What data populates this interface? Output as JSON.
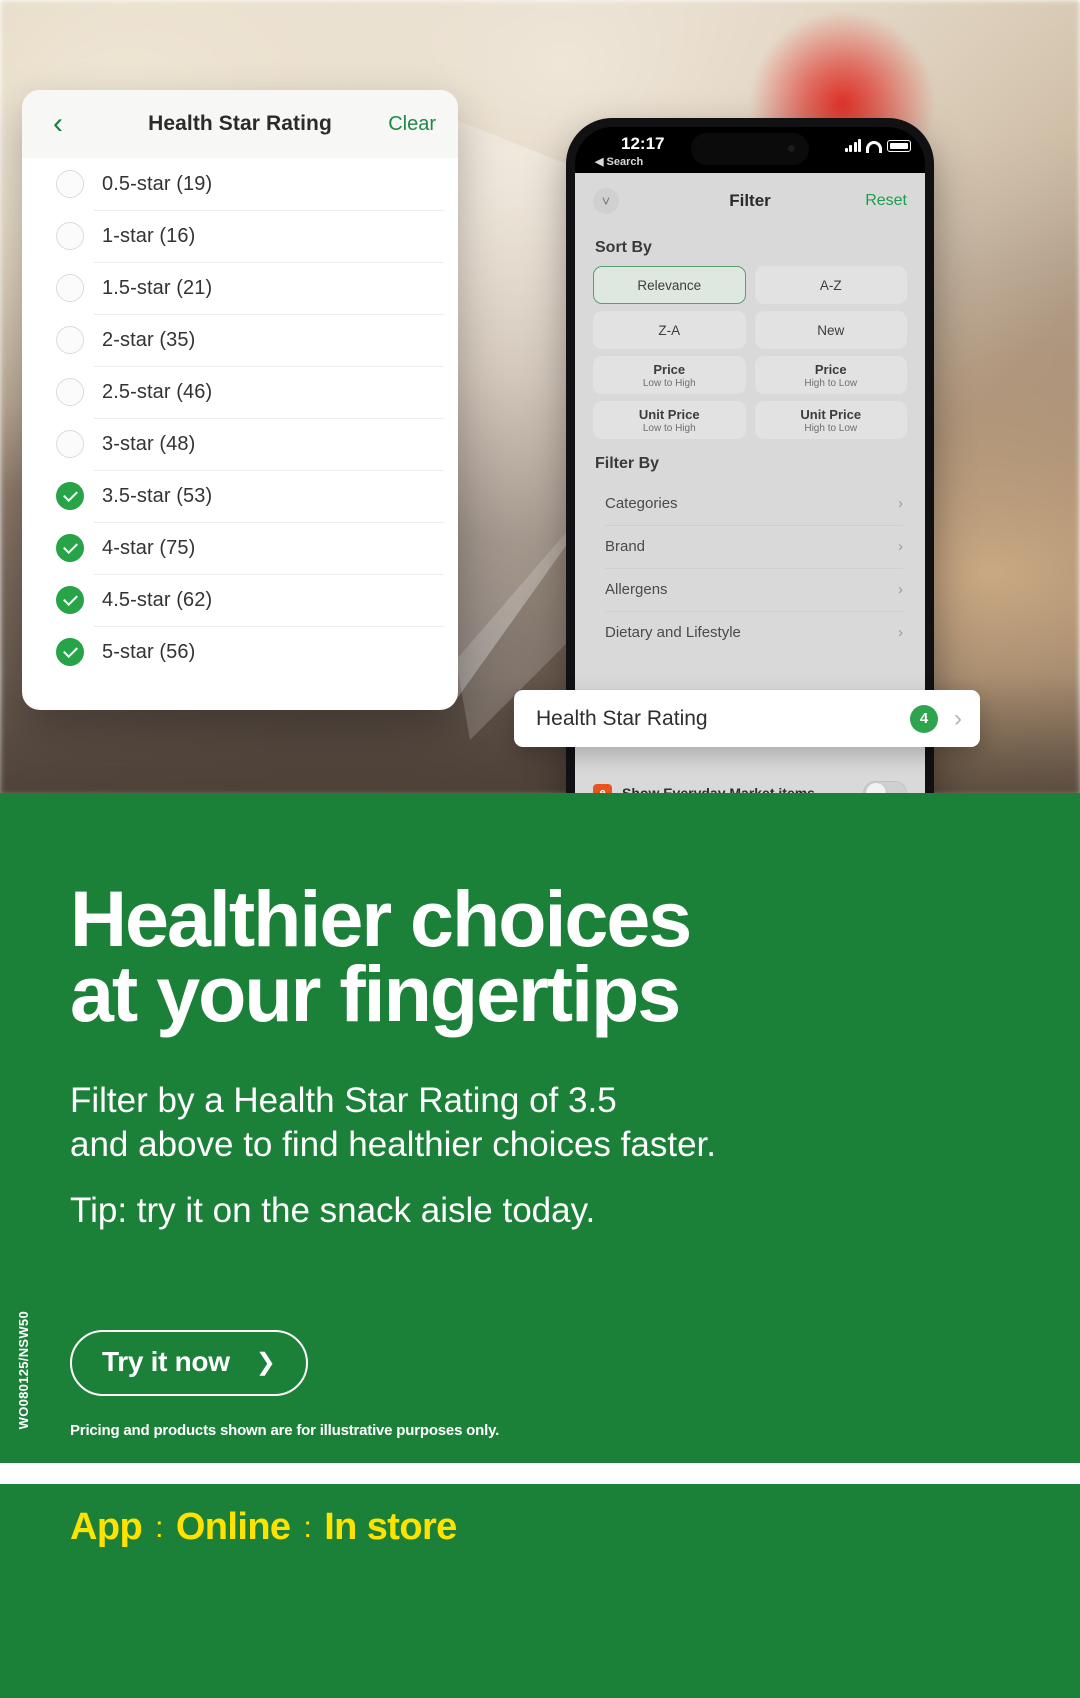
{
  "hsr_panel": {
    "back_icon": "chevron-left-icon",
    "title": "Health Star Rating",
    "clear_label": "Clear",
    "options": [
      {
        "label": "0.5-star (19)",
        "checked": false
      },
      {
        "label": "1-star (16)",
        "checked": false
      },
      {
        "label": "1.5-star (21)",
        "checked": false
      },
      {
        "label": "2-star (35)",
        "checked": false
      },
      {
        "label": "2.5-star (46)",
        "checked": false
      },
      {
        "label": "3-star (48)",
        "checked": false
      },
      {
        "label": "3.5-star (53)",
        "checked": true
      },
      {
        "label": "4-star (75)",
        "checked": true
      },
      {
        "label": "4.5-star (62)",
        "checked": true
      },
      {
        "label": "5-star (56)",
        "checked": true
      }
    ]
  },
  "phone": {
    "status": {
      "time": "12:17",
      "back_label": "Search",
      "signal_icon": "cellular-signal-icon",
      "wifi_icon": "wifi-icon",
      "battery_icon": "battery-icon"
    },
    "filter_header": {
      "collapse_icon": "chevron-down-icon",
      "title": "Filter",
      "reset_label": "Reset"
    },
    "sort_by": {
      "section_label": "Sort By",
      "options": [
        {
          "title": "Relevance",
          "sub": "",
          "selected": true
        },
        {
          "title": "A-Z",
          "sub": "",
          "selected": false
        },
        {
          "title": "Z-A",
          "sub": "",
          "selected": false
        },
        {
          "title": "New",
          "sub": "",
          "selected": false
        },
        {
          "title": "Price",
          "sub": "Low to High",
          "selected": false
        },
        {
          "title": "Price",
          "sub": "High to Low",
          "selected": false
        },
        {
          "title": "Unit Price",
          "sub": "Low to High",
          "selected": false
        },
        {
          "title": "Unit Price",
          "sub": "High to Low",
          "selected": false
        }
      ]
    },
    "filter_by": {
      "section_label": "Filter By",
      "rows": [
        {
          "label": "Categories"
        },
        {
          "label": "Brand"
        },
        {
          "label": "Allergens"
        },
        {
          "label": "Dietary and Lifestyle"
        }
      ],
      "chevron_icon": "chevron-right-icon"
    },
    "everyday_market": {
      "badge_text": "e",
      "label": "Show Everyday Market items",
      "toggle_on": false
    }
  },
  "callout": {
    "label": "Health Star Rating",
    "badge_count": "4",
    "chevron_icon": "chevron-right-icon"
  },
  "promo": {
    "headline_line1": "Healthier choices",
    "headline_line2": "at your fingertips",
    "body_line1": "Filter by a Health Star Rating of 3.5",
    "body_line2": "and above to find healthier choices faster.",
    "tip_line": "Tip: try it on the snack aisle today.",
    "cta_label": "Try it now",
    "cta_arrow": "chevron-right-icon",
    "disclaimer": "Pricing and products shown are for illustrative purposes only.",
    "code": "WO080125/NSW50",
    "brand_green": "#1b8139"
  },
  "footer": {
    "items": [
      "App",
      "Online",
      "In store"
    ],
    "separator": ":",
    "accent_yellow": "#ffe200"
  }
}
